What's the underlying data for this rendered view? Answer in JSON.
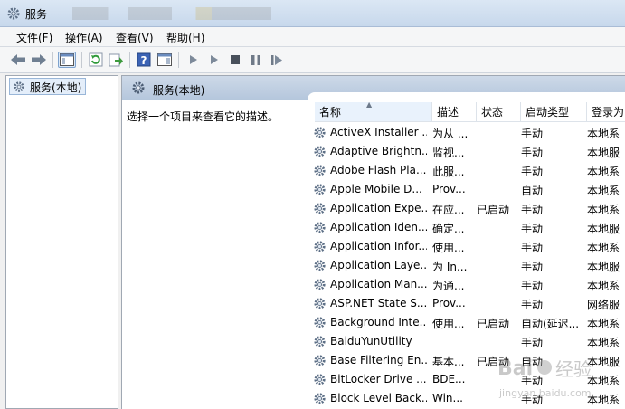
{
  "window": {
    "title": "服务"
  },
  "menu": [
    "文件(F)",
    "操作(A)",
    "查看(V)",
    "帮助(H)"
  ],
  "toolbar_icons": [
    "back-arrow-icon",
    "forward-arrow-icon",
    "console-tree-icon",
    "refresh-icon",
    "export-list-icon",
    "help-icon",
    "properties-icon",
    "start-service-icon",
    "start-service-params-icon",
    "stop-service-icon",
    "pause-service-icon",
    "restart-service-icon"
  ],
  "tree": {
    "root_label": "服务(本地)"
  },
  "pane": {
    "title": "服务(本地)",
    "description": "选择一个项目来查看它的描述。"
  },
  "columns": [
    "名称",
    "描述",
    "状态",
    "启动类型",
    "登录为"
  ],
  "rows": [
    {
      "name": "ActiveX Installer ...",
      "desc": "为从 ...",
      "status": "",
      "startup": "手动",
      "login": "本地系"
    },
    {
      "name": "Adaptive Brightn...",
      "desc": "监视...",
      "status": "",
      "startup": "手动",
      "login": "本地服"
    },
    {
      "name": "Adobe Flash Pla...",
      "desc": "此服...",
      "status": "",
      "startup": "手动",
      "login": "本地系"
    },
    {
      "name": "Apple Mobile D...",
      "desc": "Prov...",
      "status": "",
      "startup": "自动",
      "login": "本地系"
    },
    {
      "name": "Application Expe...",
      "desc": "在应...",
      "status": "已启动",
      "startup": "手动",
      "login": "本地系"
    },
    {
      "name": "Application Iden...",
      "desc": "确定...",
      "status": "",
      "startup": "手动",
      "login": "本地服"
    },
    {
      "name": "Application Infor...",
      "desc": "使用...",
      "status": "",
      "startup": "手动",
      "login": "本地系"
    },
    {
      "name": "Application Laye...",
      "desc": "为 In...",
      "status": "",
      "startup": "手动",
      "login": "本地服"
    },
    {
      "name": "Application Man...",
      "desc": "为通...",
      "status": "",
      "startup": "手动",
      "login": "本地系"
    },
    {
      "name": "ASP.NET State S...",
      "desc": "Prov...",
      "status": "",
      "startup": "手动",
      "login": "网络服"
    },
    {
      "name": "Background Inte...",
      "desc": "使用...",
      "status": "已启动",
      "startup": "自动(延迟...",
      "login": "本地系"
    },
    {
      "name": "BaiduYunUtility",
      "desc": "",
      "status": "",
      "startup": "手动",
      "login": "本地系"
    },
    {
      "name": "Base Filtering En...",
      "desc": "基本...",
      "status": "已启动",
      "startup": "自动",
      "login": "本地服"
    },
    {
      "name": "BitLocker Drive ...",
      "desc": "BDE...",
      "status": "",
      "startup": "手动",
      "login": "本地系"
    },
    {
      "name": "Block Level Back...",
      "desc": "Win...",
      "status": "",
      "startup": "手动",
      "login": "本地系"
    }
  ],
  "colors": {
    "header_band": "#b4c6dc",
    "selection": "#e4eefa",
    "gear": "#5d6f86"
  },
  "watermark": {
    "brand": "Bai",
    "text": "经验",
    "url": "jingyan.baidu.com"
  }
}
